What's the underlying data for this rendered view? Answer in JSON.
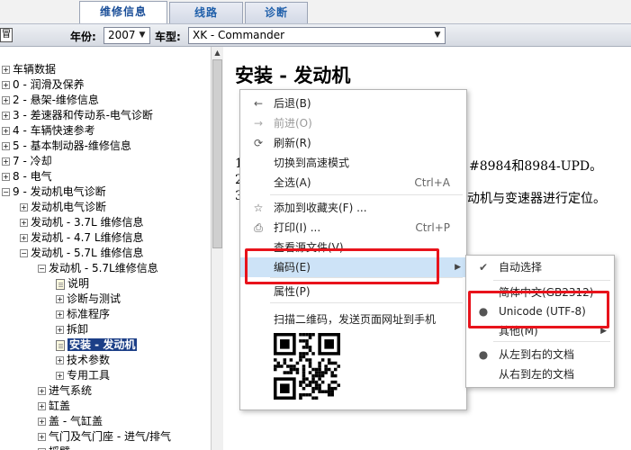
{
  "tabs": [
    {
      "label": "维修信息",
      "active": true
    },
    {
      "label": "线路",
      "active": false
    },
    {
      "label": "诊断",
      "active": false
    }
  ],
  "toolbar": {
    "year_label": "年份:",
    "year_value": "2007",
    "model_label": "车型:",
    "model_value": "XK - Commander"
  },
  "tree": {
    "items": [
      {
        "label": "车辆数据",
        "expander": "+"
      },
      {
        "label": "0 - 润滑及保养",
        "expander": "+"
      },
      {
        "label": "2 - 悬架-维修信息",
        "expander": "+"
      },
      {
        "label": "3 - 差速器和传动系-电气诊断",
        "expander": "+"
      },
      {
        "label": "4 - 车辆快速参考",
        "expander": "+"
      },
      {
        "label": "5 - 基本制动器-维修信息",
        "expander": "+"
      },
      {
        "label": "7 - 冷却",
        "expander": "+"
      },
      {
        "label": "8 - 电气",
        "expander": "+"
      },
      {
        "label": "9 - 发动机电气诊断",
        "expander": "−"
      },
      {
        "label": "发动机电气诊断",
        "expander": "+"
      },
      {
        "label": "发动机 - 3.7L 维修信息",
        "expander": "+"
      },
      {
        "label": "发动机 - 4.7 L维修信息",
        "expander": "+"
      },
      {
        "label": "发动机 - 5.7L 维修信息",
        "expander": "−"
      },
      {
        "label": "发动机 - 5.7L维修信息",
        "expander": "−"
      },
      {
        "label": "说明",
        "expander": "doc"
      },
      {
        "label": "诊断与测试",
        "expander": "+"
      },
      {
        "label": "标准程序",
        "expander": "+"
      },
      {
        "label": "拆卸",
        "expander": "+"
      },
      {
        "label": "安装 - 发动机",
        "expander": "doc",
        "selected": true
      },
      {
        "label": "技术参数",
        "expander": "+"
      },
      {
        "label": "专用工具",
        "expander": "+"
      },
      {
        "label": "进气系统",
        "expander": "+"
      },
      {
        "label": "缸盖",
        "expander": "+"
      },
      {
        "label": "盖 - 气缸盖",
        "expander": "+"
      },
      {
        "label": "气门及气门座 - 进气/排气",
        "expander": "+"
      },
      {
        "label": "摇臂",
        "expander": "+"
      }
    ]
  },
  "content": {
    "title": "安装 - 发动机",
    "line1": "1",
    "line1_right": "#8984和8984-UPD。",
    "line2": "2",
    "line3": "3",
    "line3_right": "动机与变速器进行定位。"
  },
  "context_menu": {
    "items": [
      {
        "label": "后退(B)",
        "icon": "back-arrow-icon",
        "glyph": "←",
        "shortcut": "",
        "disabled": false
      },
      {
        "label": "前进(O)",
        "icon": "forward-arrow-icon",
        "glyph": "→",
        "shortcut": "",
        "disabled": true
      },
      {
        "label": "刷新(R)",
        "icon": "refresh-icon",
        "glyph": "⟳",
        "shortcut": "",
        "disabled": false
      },
      {
        "label": "切换到高速模式",
        "icon": "",
        "glyph": "",
        "shortcut": "",
        "disabled": false
      },
      {
        "label": "全选(A)",
        "icon": "",
        "glyph": "",
        "shortcut": "Ctrl+A",
        "disabled": false
      },
      {
        "label": "添加到收藏夹(F) ...",
        "icon": "star-icon",
        "glyph": "☆",
        "shortcut": "",
        "disabled": false
      },
      {
        "label": "打印(I) ...",
        "icon": "printer-icon",
        "glyph": "⎙",
        "shortcut": "Ctrl+P",
        "disabled": false
      },
      {
        "label": "查看源文件(V)",
        "icon": "",
        "glyph": "",
        "shortcut": "",
        "disabled": false
      },
      {
        "label": "编码(E)",
        "icon": "",
        "glyph": "",
        "shortcut": "",
        "disabled": false,
        "submenu": true
      },
      {
        "label": "属性(P)",
        "icon": "",
        "glyph": "",
        "shortcut": "",
        "disabled": false
      }
    ],
    "qr_label": "扫描二维码，发送页面网址到手机"
  },
  "encoding_submenu": {
    "items": [
      {
        "label": "自动选择",
        "mark": "✔"
      },
      {
        "label": "简体中文(GB2312)",
        "mark": ""
      },
      {
        "label": "Unicode (UTF-8)",
        "mark": "●"
      },
      {
        "label": "其他(M)",
        "mark": "",
        "submenu": true
      },
      {
        "label": "从左到右的文档",
        "mark": "●"
      },
      {
        "label": "从右到左的文档",
        "mark": ""
      }
    ]
  },
  "colors": {
    "highlight_box": "#e8131b",
    "selection": "#1c3f87",
    "menu_hover": "#cde3f7"
  }
}
